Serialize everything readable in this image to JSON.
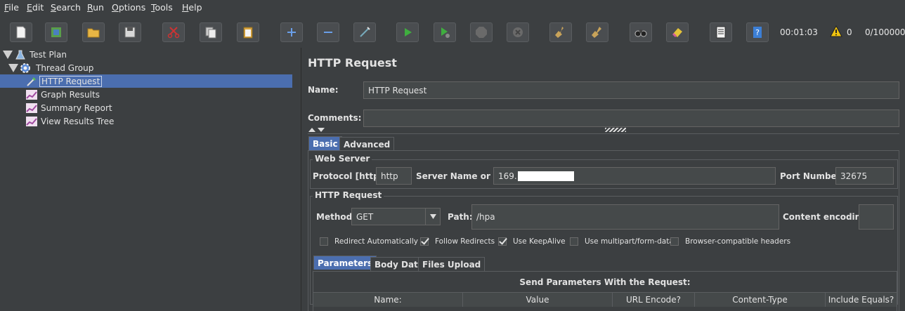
{
  "menu": [
    "File",
    "Edit",
    "Search",
    "Run",
    "Options",
    "Tools",
    "Help"
  ],
  "toolbar": {
    "timer": "00:01:03",
    "warnings": "0",
    "threads": "0/100000"
  },
  "tree": {
    "items": [
      {
        "label": "Test Plan",
        "icon": "test-plan-icon"
      },
      {
        "label": "Thread Group",
        "icon": "gear-icon"
      },
      {
        "label": "HTTP Request",
        "icon": "pipette-icon"
      },
      {
        "label": "Graph Results",
        "icon": "graph-icon"
      },
      {
        "label": "Summary Report",
        "icon": "graph-icon"
      },
      {
        "label": "View Results Tree",
        "icon": "graph-icon"
      }
    ]
  },
  "panel": {
    "title": "HTTP Request",
    "name_label": "Name:",
    "name_value": "HTTP Request",
    "comments_label": "Comments:",
    "comments_value": "",
    "tabs": [
      "Basic",
      "Advanced"
    ],
    "web_server": {
      "title": "Web Server",
      "protocol_label": "Protocol [http]:",
      "protocol_value": "http",
      "server_label": "Server Name or IP:",
      "server_value": "169.",
      "port_label": "Port Number:",
      "port_value": "32675"
    },
    "http_request": {
      "title": "HTTP Request",
      "method_label": "Method:",
      "method_value": "GET",
      "path_label": "Path:",
      "path_value": "/hpa",
      "encoding_label": "Content encoding:",
      "encoding_value": ""
    },
    "checkboxes": [
      {
        "label": "Redirect Automatically",
        "checked": false
      },
      {
        "label": "Follow Redirects",
        "checked": true
      },
      {
        "label": "Use KeepAlive",
        "checked": true
      },
      {
        "label": "Use multipart/form-data",
        "checked": false
      },
      {
        "label": "Browser-compatible headers",
        "checked": false
      }
    ],
    "sub_tabs": [
      "Parameters",
      "Body Data",
      "Files Upload"
    ],
    "params_title": "Send Parameters With the Request:",
    "columns": [
      "Name:",
      "Value",
      "URL Encode?",
      "Content-Type",
      "Include Equals?"
    ]
  },
  "colors": {
    "background": "#3c3f41",
    "selection": "#4b6eaf",
    "field": "#45494a"
  }
}
